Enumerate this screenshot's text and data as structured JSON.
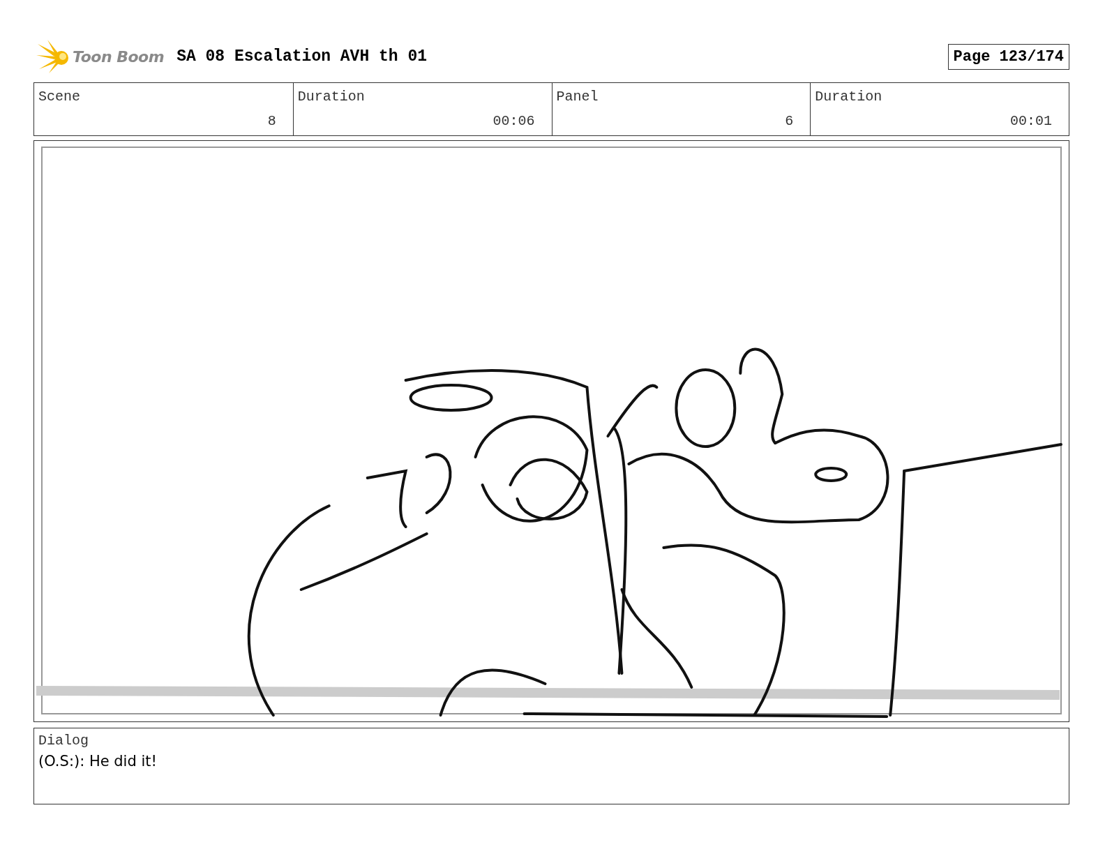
{
  "header": {
    "logo": "Toon Boom",
    "title": "SA 08 Escalation AVH th 01",
    "page": "Page 123/174"
  },
  "info": [
    {
      "label": "Scene",
      "value": "8"
    },
    {
      "label": "Duration",
      "value": "00:06"
    },
    {
      "label": "Panel",
      "value": "6"
    },
    {
      "label": "Duration",
      "value": "00:01"
    }
  ],
  "panel": {
    "kind": "sketch"
  },
  "dialog": {
    "label": "Dialog",
    "text": "(O.S:): He did it!"
  }
}
